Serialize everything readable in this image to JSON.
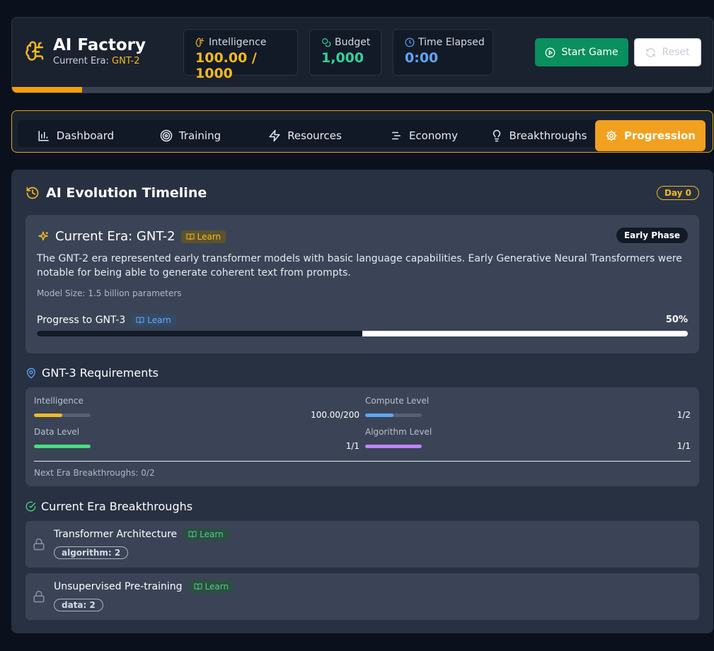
{
  "app": {
    "title": "AI Factory",
    "era_label": "Current Era:",
    "era_value": "GNT-2",
    "progress_fraction": 0.1
  },
  "stats": {
    "intelligence": {
      "label": "Intelligence",
      "value": "100.00 / 1000",
      "color": "#f5b921"
    },
    "budget": {
      "label": "Budget",
      "value": "1,000",
      "color": "#34d399"
    },
    "time": {
      "label": "Time Elapsed",
      "value": "0:00",
      "color": "#60a5fa"
    }
  },
  "buttons": {
    "start": "Start Game",
    "reset": "Reset"
  },
  "tabs": [
    {
      "label": "Dashboard",
      "icon": "bar-chart-icon"
    },
    {
      "label": "Training",
      "icon": "target-icon"
    },
    {
      "label": "Resources",
      "icon": "lightning-icon"
    },
    {
      "label": "Economy",
      "icon": "lines-icon"
    },
    {
      "label": "Breakthroughs",
      "icon": "lightbulb-icon"
    },
    {
      "label": "Progression",
      "icon": "gear-icon",
      "active": true
    }
  ],
  "timeline": {
    "title": "AI Evolution Timeline",
    "day_badge": "Day 0"
  },
  "current_era": {
    "title": "Current Era: GNT-2",
    "learn": "Learn",
    "phase": "Early Phase",
    "description": "The GNT-2 era represented early transformer models with basic language capabilities. Early Generative Neural Transformers were notable for being able to generate coherent text from prompts.",
    "model_size": "Model Size: 1.5 billion parameters",
    "progress_label": "Progress to GNT-3",
    "progress_learn": "Learn",
    "progress_percent": "50%",
    "progress_value": 0.5
  },
  "requirements": {
    "title": "GNT-3 Requirements",
    "items": [
      {
        "name": "Intelligence",
        "value": "100.00/200",
        "fraction": 0.5,
        "color": "#f5b921"
      },
      {
        "name": "Compute Level",
        "value": "1/2",
        "fraction": 0.5,
        "color": "#60a5fa"
      },
      {
        "name": "Data Level",
        "value": "1/1",
        "fraction": 1.0,
        "color": "#4ade80"
      },
      {
        "name": "Algorithm Level",
        "value": "1/1",
        "fraction": 1.0,
        "color": "#c084fc"
      }
    ],
    "next_breakthroughs": "Next Era Breakthroughs: 0/2"
  },
  "breakthroughs": {
    "title": "Current Era Breakthroughs",
    "items": [
      {
        "name": "Transformer Architecture",
        "learn": "Learn",
        "tag": "algorithm: 2"
      },
      {
        "name": "Unsupervised Pre-training",
        "learn": "Learn",
        "tag": "data: 2"
      }
    ]
  }
}
